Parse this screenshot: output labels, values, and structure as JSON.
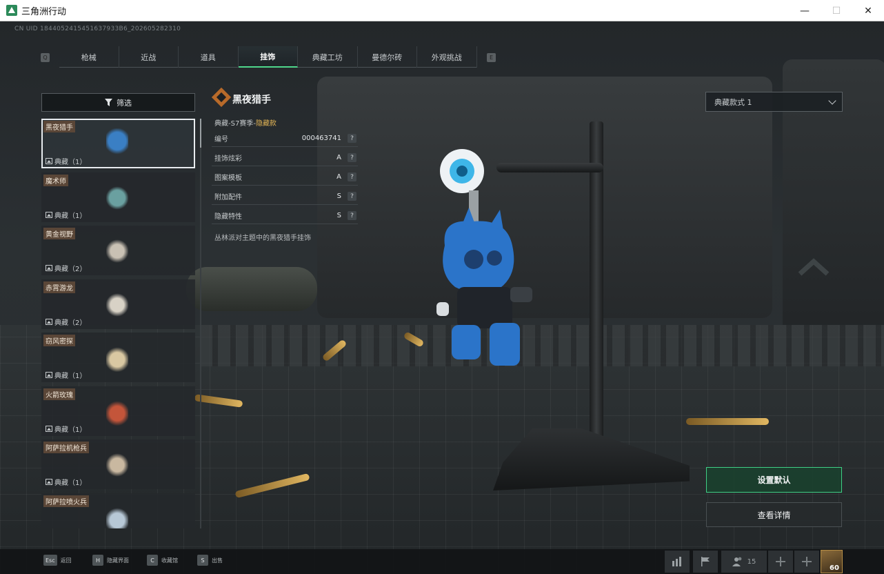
{
  "window": {
    "title": "三角洲行动",
    "minimize": "—",
    "maximize": "☐",
    "close": "✕"
  },
  "uid": "CN UID 1844052415451637933B6_202605282310",
  "tabs": [
    {
      "label": "枪械",
      "active": false
    },
    {
      "label": "近战",
      "active": false
    },
    {
      "label": "道具",
      "active": false
    },
    {
      "label": "挂饰",
      "active": true
    },
    {
      "label": "典藏工坊",
      "active": false
    },
    {
      "label": "曼德尔砖",
      "active": false
    },
    {
      "label": "外观挑战",
      "active": false
    }
  ],
  "tab_keys": {
    "left": "Q",
    "right": "E"
  },
  "filter": {
    "label": "筛选"
  },
  "items": [
    {
      "name": "黑夜猎手",
      "tag": "典藏（1）",
      "selected": true,
      "color": "#3a7fc4"
    },
    {
      "name": "魔术师",
      "tag": "典藏（1）",
      "selected": false,
      "color": "#6aa0a0"
    },
    {
      "name": "黄金视野",
      "tag": "典藏（2）",
      "selected": false,
      "color": "#c9c1b4"
    },
    {
      "name": "赤霄游龙",
      "tag": "典藏（2）",
      "selected": false,
      "color": "#d8d2c6"
    },
    {
      "name": "窃风密探",
      "tag": "典藏（1）",
      "selected": false,
      "color": "#d9c8a2"
    },
    {
      "name": "火箭玫瑰",
      "tag": "典藏（1）",
      "selected": false,
      "color": "#c4553a"
    },
    {
      "name": "阿萨拉机枪兵",
      "tag": "典藏（1）",
      "selected": false,
      "color": "#c9b8a0"
    },
    {
      "name": "阿萨拉喷火兵",
      "tag": "",
      "selected": false,
      "color": "#b7c8d6"
    }
  ],
  "detail": {
    "title": "黑夜猎手",
    "subtitle_prefix": "典藏-S7赛季-",
    "subtitle_highlight": "隐藏款",
    "props": [
      {
        "label": "编号",
        "value": "000463741"
      },
      {
        "label": "挂饰炫彩",
        "value": "A"
      },
      {
        "label": "图案模板",
        "value": "A"
      },
      {
        "label": "附加配件",
        "value": "S"
      },
      {
        "label": "隐藏特性",
        "value": "S"
      }
    ],
    "help": "?",
    "description": "丛林派对主题中的黑夜猎手挂饰"
  },
  "style_select": {
    "value": "典藏款式 1"
  },
  "actions": {
    "set_default": "设置默认",
    "view_details": "查看详情"
  },
  "bottom_hints": [
    {
      "key": "Esc",
      "label": "返回"
    },
    {
      "key": "H",
      "label": "隐藏界面"
    },
    {
      "key": "C",
      "label": "收藏馆"
    },
    {
      "key": "S",
      "label": "出售"
    }
  ],
  "hud": {
    "friends_count": "15",
    "level": "60"
  },
  "colors": {
    "accent": "#3fd085",
    "highlight": "#e2b455",
    "name_tag": "#5a4637"
  }
}
